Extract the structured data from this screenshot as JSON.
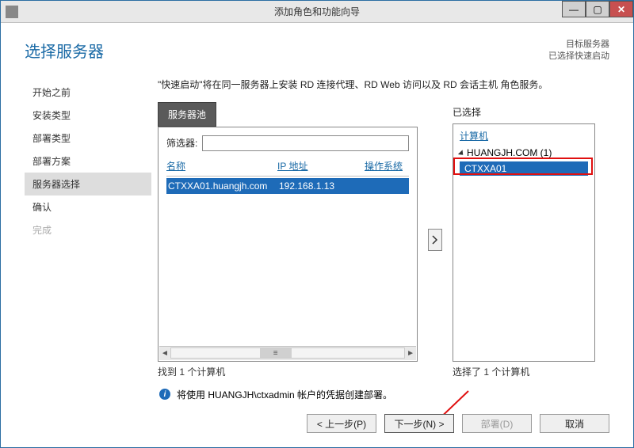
{
  "window": {
    "title": "添加角色和功能向导"
  },
  "header": {
    "heading": "选择服务器",
    "meta1": "目标服务器",
    "meta2": "已选择快速启动"
  },
  "sidebar": {
    "items": [
      {
        "label": "开始之前"
      },
      {
        "label": "安装类型"
      },
      {
        "label": "部署类型"
      },
      {
        "label": "部署方案"
      },
      {
        "label": "服务器选择"
      },
      {
        "label": "确认"
      },
      {
        "label": "完成"
      }
    ]
  },
  "main": {
    "desc": "\"快速启动\"将在同一服务器上安装 RD 连接代理、RD Web 访问以及 RD 会话主机 角色服务。",
    "pool": {
      "tab": "服务器池",
      "filter_label": "筛选器:",
      "filter_value": "",
      "col_name": "名称",
      "col_ip": "IP 地址",
      "col_os": "操作系统",
      "rows": [
        {
          "name": "CTXXA01.huangjh.com",
          "ip": "192.168.1.13",
          "os": ""
        }
      ],
      "status": "找到 1 个计算机"
    },
    "selected": {
      "panel_label": "已选择",
      "col_computer": "计算机",
      "domain": "HUANGJH.COM (1)",
      "leaf": "CTXXA01",
      "status": "选择了 1 个计算机"
    },
    "info": "将使用 HUANGJH\\ctxadmin 帐户的凭据创建部署。"
  },
  "footer": {
    "prev": "< 上一步(P)",
    "next": "下一步(N) >",
    "deploy": "部署(D)",
    "cancel": "取消"
  }
}
